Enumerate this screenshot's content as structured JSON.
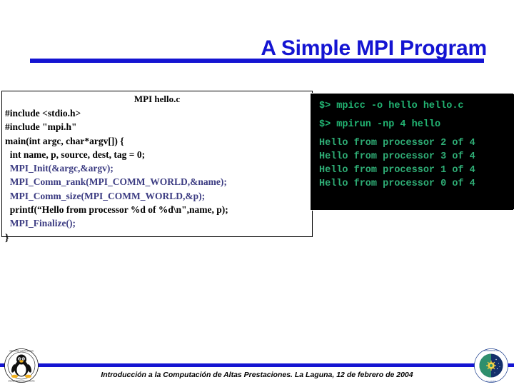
{
  "slide": {
    "title": "A Simple MPI Program",
    "accent_color": "#1414d2"
  },
  "code_panel": {
    "caption": "MPI hello.c",
    "mpi_color": "#3c3c82",
    "text_color": "#000000",
    "lines": [
      {
        "text": "#include <stdio.h>",
        "style": "plain"
      },
      {
        "text": "#include \"mpi.h\"",
        "style": "plain"
      },
      {
        "text": "main(int argc, char*argv[]) {",
        "style": "plain"
      },
      {
        "text": "  int name, p, source, dest, tag = 0;",
        "style": "plain"
      },
      {
        "text": "  MPI_Init(&argc,&argv);",
        "style": "mpi"
      },
      {
        "text": "  MPI_Comm_rank(MPI_COMM_WORLD,&name);",
        "style": "mpi"
      },
      {
        "text": "  MPI_Comm_size(MPI_COMM_WORLD,&p);",
        "style": "mpi"
      },
      {
        "text": "  printf(“Hello from processor %d of %d\\n\",name, p);",
        "style": "plain"
      },
      {
        "text": "  MPI_Finalize();",
        "style": "mpi"
      },
      {
        "text": "}",
        "style": "plain"
      }
    ]
  },
  "terminal": {
    "background_color": "#000000",
    "text_color": "#22b573",
    "lines": [
      {
        "text": "$> mpicc -o hello hello.c",
        "kind": "cmd"
      },
      {
        "text": "$> mpirun -np 4 hello",
        "kind": "cmd"
      },
      {
        "text": "Hello from processor 2 of 4",
        "kind": "out"
      },
      {
        "text": "Hello from processor 3 of 4",
        "kind": "out"
      },
      {
        "text": "Hello from processor 1 of 4",
        "kind": "out"
      },
      {
        "text": "Hello from processor 0 of 4",
        "kind": "out"
      }
    ]
  },
  "footer": {
    "text": "Introducción a la Computación de Altas Prestaciones. La Laguna, 12 de febrero de 2004"
  },
  "logos": {
    "left_name": "linux-tux-seal-logo",
    "right_name": "universidad-la-laguna-seal-logo"
  }
}
